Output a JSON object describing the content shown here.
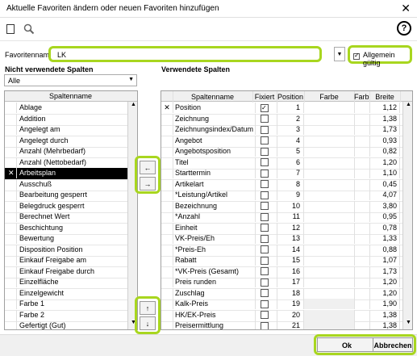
{
  "window": {
    "title": "Aktuelle Favoriten ändern oder neuen Favoriten hinzufügen"
  },
  "toolbar": {
    "help_label": "?"
  },
  "favorit": {
    "label": "Favoritenname",
    "value": "LK",
    "allgemein_label": "Allgemein gültig",
    "allgemein_checked": true
  },
  "left": {
    "title": "Nicht verwendete Spalten",
    "filter": "Alle",
    "column_header": "Spaltenname",
    "selected_index": 6,
    "items": [
      "Ablage",
      "Addition",
      "Angelegt am",
      "Angelegt durch",
      "Anzahl (Mehrbedarf)",
      "Anzahl (Nettobedarf)",
      "Arbeitsplan",
      "Ausschuß",
      "Bearbeitung gesperrt",
      "Belegdruck gesperrt",
      "Berechnet Wert",
      "Beschichtung",
      "Bewertung",
      "Disposition Position",
      "Einkauf Freigabe am",
      "Einkauf Freigabe durch",
      "Einzelfläche",
      "Einzelgewicht",
      "Farbe 1",
      "Farbe 2",
      "Gefertigt (Gut)"
    ]
  },
  "right": {
    "title": "Verwendete Spalten",
    "headers": {
      "name": "Spaltenname",
      "fixiert": "Fixiert",
      "position": "Position",
      "farbe": "Farbe",
      "farb": "Farb",
      "breite": "Breite"
    },
    "rows": [
      {
        "name": "Position",
        "fixiert": true,
        "position": "1",
        "breite": "1,12"
      },
      {
        "name": "Zeichnung",
        "fixiert": false,
        "position": "2",
        "breite": "1,38"
      },
      {
        "name": "Zeichnungsindex/Datum",
        "fixiert": false,
        "position": "3",
        "breite": "1,73"
      },
      {
        "name": "Angebot",
        "fixiert": false,
        "position": "4",
        "breite": "0,93"
      },
      {
        "name": "Angebotsposition",
        "fixiert": false,
        "position": "5",
        "breite": "0,82"
      },
      {
        "name": "Titel",
        "fixiert": false,
        "position": "6",
        "breite": "1,20"
      },
      {
        "name": "Starttermin",
        "fixiert": false,
        "position": "7",
        "breite": "1,10"
      },
      {
        "name": "Artikelart",
        "fixiert": false,
        "position": "8",
        "breite": "0,45"
      },
      {
        "name": "*Leistung/Artikel",
        "fixiert": false,
        "position": "9",
        "breite": "4,07"
      },
      {
        "name": "Bezeichnung",
        "fixiert": false,
        "position": "10",
        "breite": "3,80"
      },
      {
        "name": "*Anzahl",
        "fixiert": false,
        "position": "11",
        "breite": "0,95"
      },
      {
        "name": "Einheit",
        "fixiert": false,
        "position": "12",
        "breite": "0,78"
      },
      {
        "name": "VK-Preis/Eh",
        "fixiert": false,
        "position": "13",
        "breite": "1,33"
      },
      {
        "name": "*Preis-Eh",
        "fixiert": false,
        "position": "14",
        "breite": "0,88"
      },
      {
        "name": "Rabatt",
        "fixiert": false,
        "position": "15",
        "breite": "1,07"
      },
      {
        "name": "*VK-Preis (Gesamt)",
        "fixiert": false,
        "position": "16",
        "breite": "1,73"
      },
      {
        "name": "Preis runden",
        "fixiert": false,
        "position": "17",
        "breite": "1,20"
      },
      {
        "name": "Zuschlag",
        "fixiert": false,
        "position": "18",
        "breite": "1,20"
      },
      {
        "name": "Kalk-Preis",
        "fixiert": false,
        "position": "19",
        "breite": "1,90"
      },
      {
        "name": "HK/EK-Preis",
        "fixiert": false,
        "position": "20",
        "breite": "1,38"
      },
      {
        "name": "Preisermittlung",
        "fixiert": false,
        "position": "21",
        "breite": "1,38"
      }
    ]
  },
  "move_buttons": {
    "left": "←",
    "right": "→",
    "up": "↑",
    "down": "↓"
  },
  "footer": {
    "ok": "Ok",
    "cancel": "Abbrechen"
  },
  "colors": {
    "highlight": "#a8d61f",
    "selection": "#000000"
  }
}
